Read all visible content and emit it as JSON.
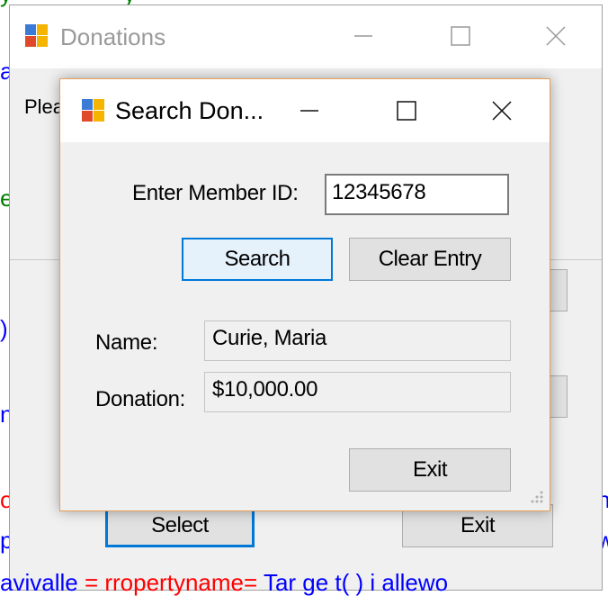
{
  "background_code": {
    "fragments": [
      "a",
      "e",
      "i",
      ")",
      "n",
      "o",
      "n",
      "p",
      "w",
      "avivalle",
      "= rropertyname=",
      "Tar ge t( ) i allewo"
    ],
    "colors": {
      "blue": "#0000ff",
      "green": "#008000",
      "red": "#ff0000"
    }
  },
  "parent_window": {
    "title": "Donations",
    "prompt_text": "Plea",
    "select_label": "Select",
    "exit_label": "Exit"
  },
  "dialog": {
    "title": "Search Don...",
    "member_id_label": "Enter Member ID:",
    "member_id_value": "12345678",
    "search_label": "Search",
    "clear_label": "Clear Entry",
    "name_label": "Name:",
    "name_value": "Curie, Maria",
    "donation_label": "Donation:",
    "donation_value": "$10,000.00",
    "exit_label": "Exit"
  },
  "icons": {
    "minimize": "minimize-icon",
    "maximize": "maximize-icon",
    "close": "close-icon",
    "app": "app-form-icon"
  },
  "colors": {
    "dialog_border": "#e8a05a",
    "focus_border": "#0078d7",
    "button_face": "#e1e1e1",
    "window_face": "#f0f0f0"
  }
}
